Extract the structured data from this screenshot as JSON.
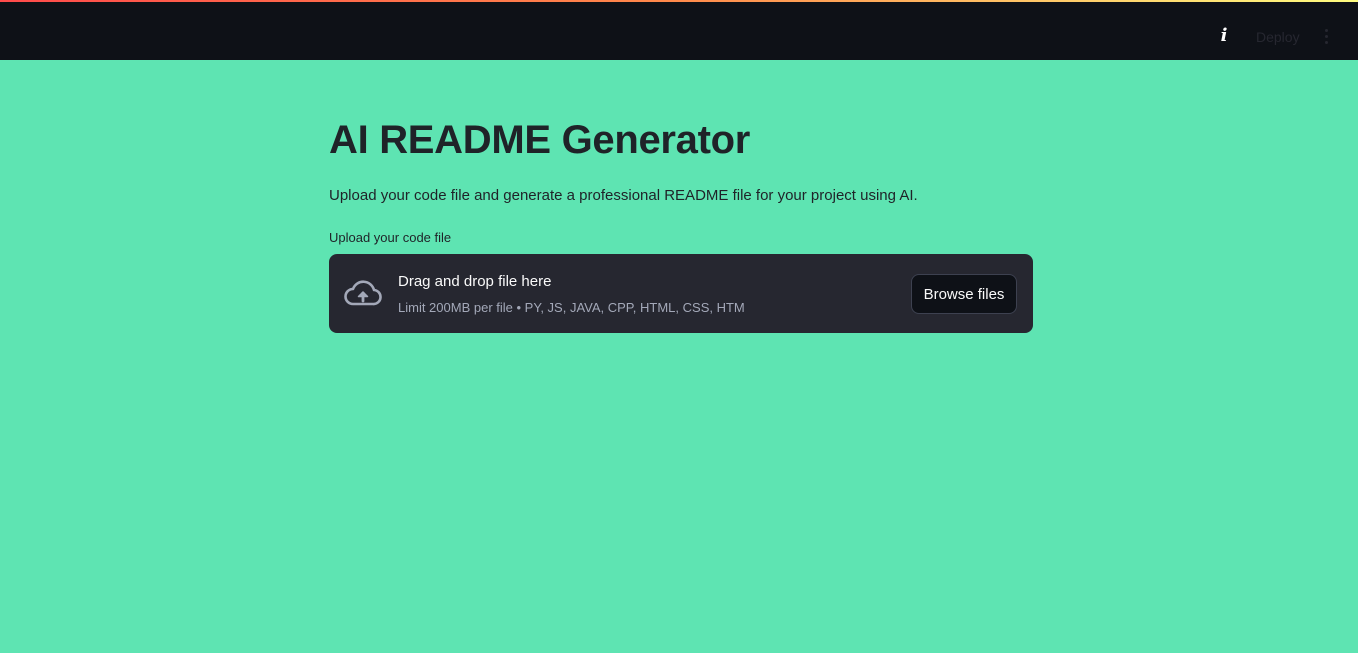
{
  "header": {
    "info_icon": "info-icon",
    "deploy_label": "Deploy",
    "menu_icon": "more-vertical-icon"
  },
  "main": {
    "title": "AI README Generator",
    "subtitle": "Upload your code file and generate a professional README file for your project using AI.",
    "uploader": {
      "label": "Upload your code file",
      "drop_title": "Drag and drop file here",
      "limit_text": "Limit 200MB per file • PY, JS, JAVA, CPP, HTML, CSS, HTM",
      "browse_label": "Browse files",
      "icon": "cloud-upload-icon"
    }
  },
  "colors": {
    "background": "#5ee4b2",
    "header": "#0e1117",
    "dropzone": "#262730",
    "text": "#1f2328"
  }
}
